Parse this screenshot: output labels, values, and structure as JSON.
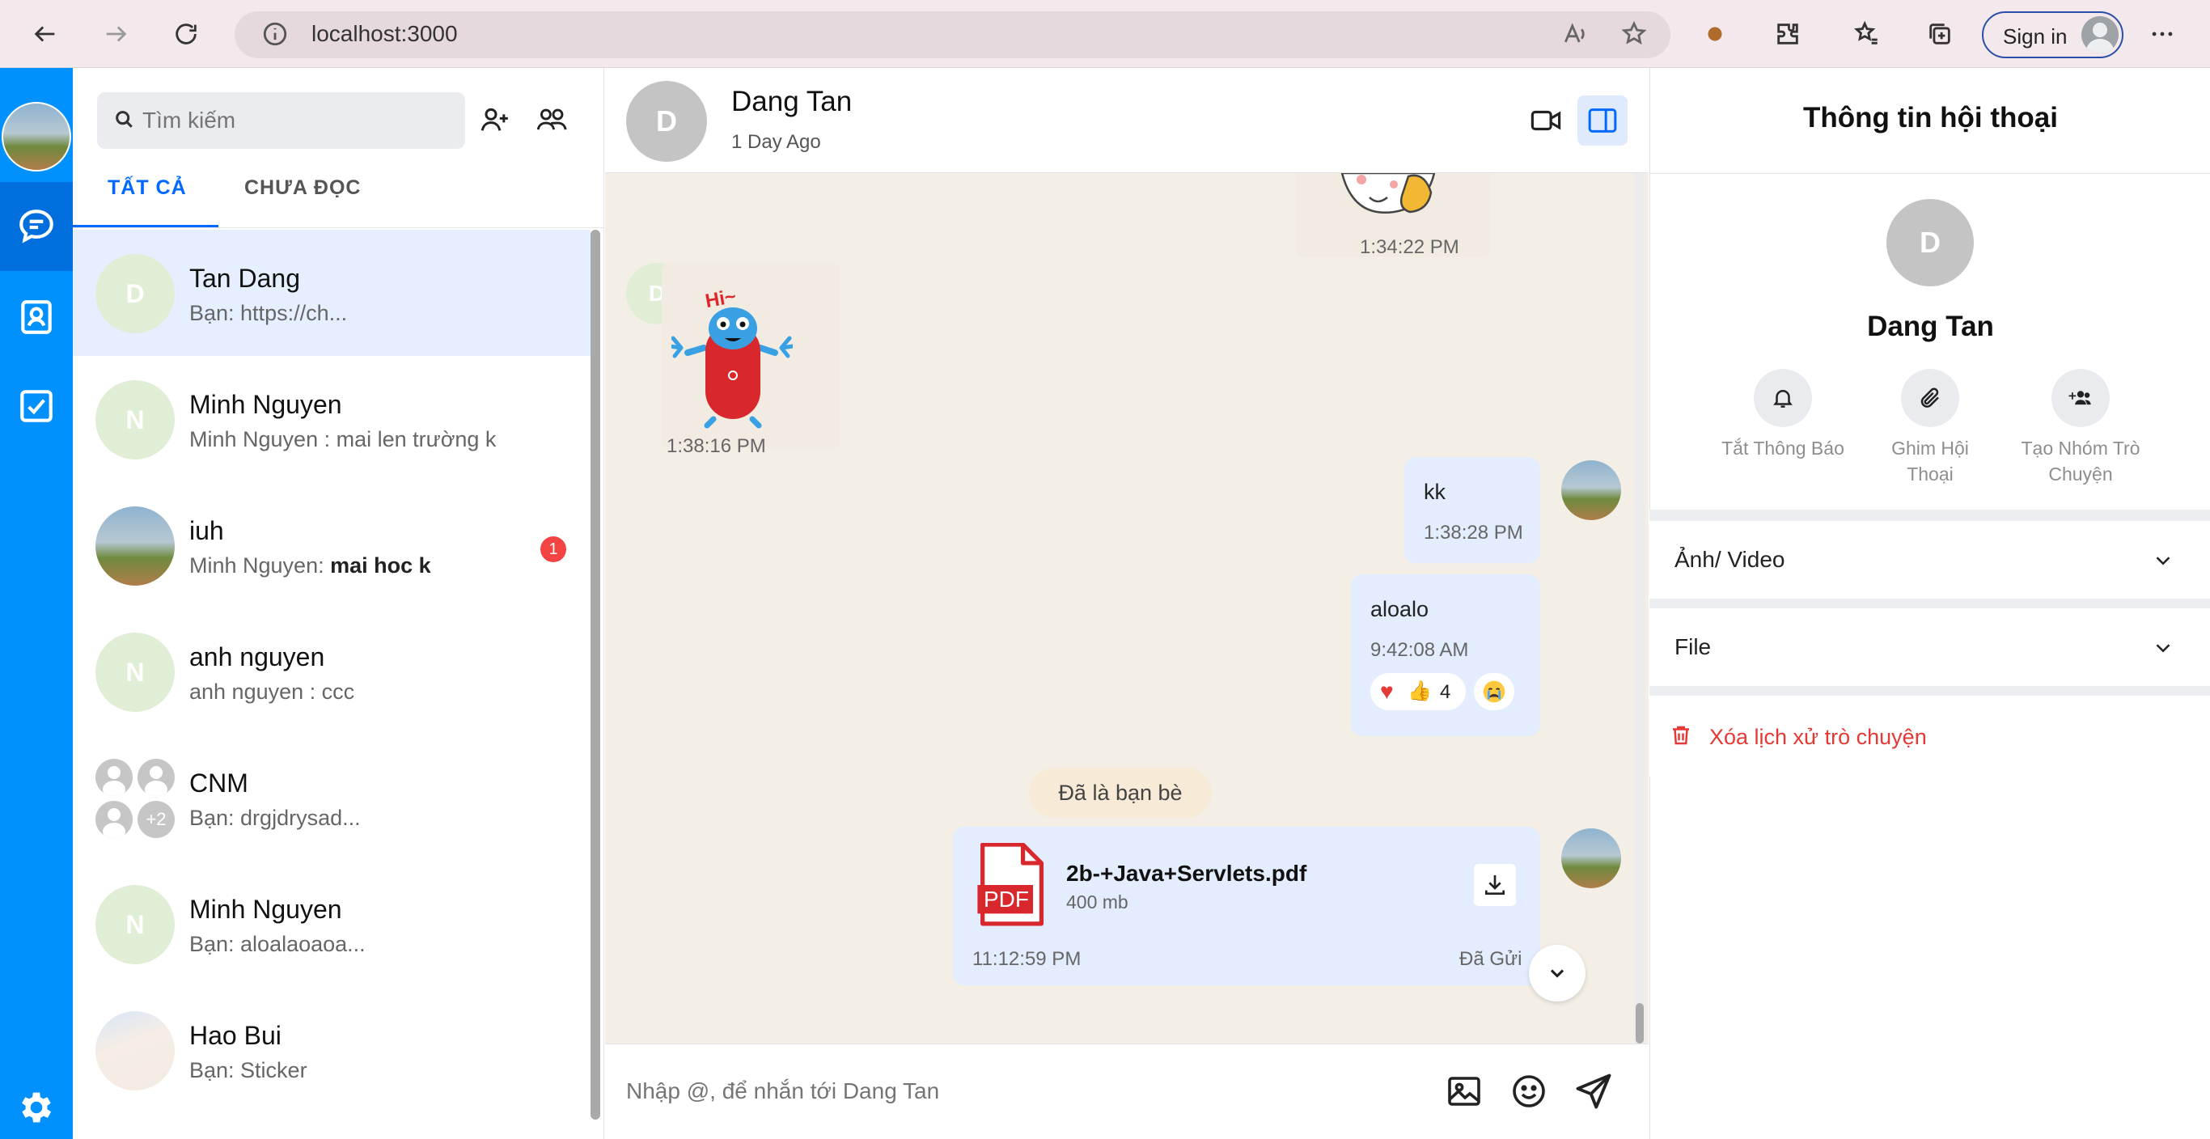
{
  "browser": {
    "url": "localhost:3000",
    "signin_label": "Sign in"
  },
  "search": {
    "placeholder": "Tìm kiếm"
  },
  "tabs": [
    {
      "label": "TẤT CẢ",
      "active": true
    },
    {
      "label": "CHƯA ĐỌC",
      "active": false
    }
  ],
  "conversations": [
    {
      "name": "Tan Dang",
      "preview": "Bạn: https://ch...",
      "avatar": "D",
      "active": true
    },
    {
      "name": "Minh Nguyen",
      "preview": "Minh Nguyen : mai len trường k",
      "avatar": "N"
    },
    {
      "name": "iuh",
      "preview_sender": "Minh Nguyen: ",
      "preview_bold": "mai hoc k",
      "badge": "1",
      "avatar": "photo"
    },
    {
      "name": "anh nguyen",
      "preview": "anh nguyen : ccc",
      "avatar": "N"
    },
    {
      "name": "CNM",
      "preview": "Bạn: drgjdrysad...",
      "avatar": "group",
      "group_extra": "+2"
    },
    {
      "name": "Minh Nguyen",
      "preview": "Bạn: aloalaoaoa...",
      "avatar": "N"
    },
    {
      "name": "Hao Bui",
      "preview": "Bạn: Sticker",
      "avatar": "photo-blur"
    }
  ],
  "chat": {
    "title": "Dang Tan",
    "subtitle": "1 Day Ago",
    "avatar": "D",
    "messages": [
      {
        "type": "sticker",
        "time": "1:34:22 PM",
        "side": "right"
      },
      {
        "type": "sticker",
        "time": "1:38:16 PM",
        "side": "left",
        "sticker_text": "Hi~"
      },
      {
        "type": "text",
        "text": "kk",
        "time": "1:38:28 PM",
        "side": "right"
      },
      {
        "type": "text",
        "text": "aloalo",
        "time": "9:42:08 AM",
        "side": "right",
        "reaction_count": "4"
      },
      {
        "type": "notice",
        "text": "Đã là bạn bè"
      },
      {
        "type": "file",
        "file_name": "2b-+Java+Servlets.pdf",
        "file_size": "400 mb",
        "file_icon_label": "PDF",
        "time": "11:12:59 PM",
        "status": "Đã Gửi",
        "side": "right"
      }
    ],
    "input_placeholder": "Nhập @, để nhắn tới Dang Tan"
  },
  "info": {
    "title": "Thông tin hội thoại",
    "name": "Dang Tan",
    "avatar": "D",
    "actions": [
      {
        "label": "Tắt Thông Báo",
        "icon": "bell-icon"
      },
      {
        "label": "Ghim Hội Thoại",
        "icon": "paperclip-icon"
      },
      {
        "label": "Tạo Nhóm Trò Chuyện",
        "icon": "add-group-icon"
      }
    ],
    "sections": [
      "Ảnh/ Video",
      "File"
    ],
    "delete_label": "Xóa lịch xử trò chuyện"
  },
  "colors": {
    "rail": "#0091ff",
    "active_tab": "#0068ff",
    "bubble": "#e4edfd",
    "chat_bg": "#f4efe6",
    "danger": "#e53935",
    "badge": "#f44343"
  }
}
